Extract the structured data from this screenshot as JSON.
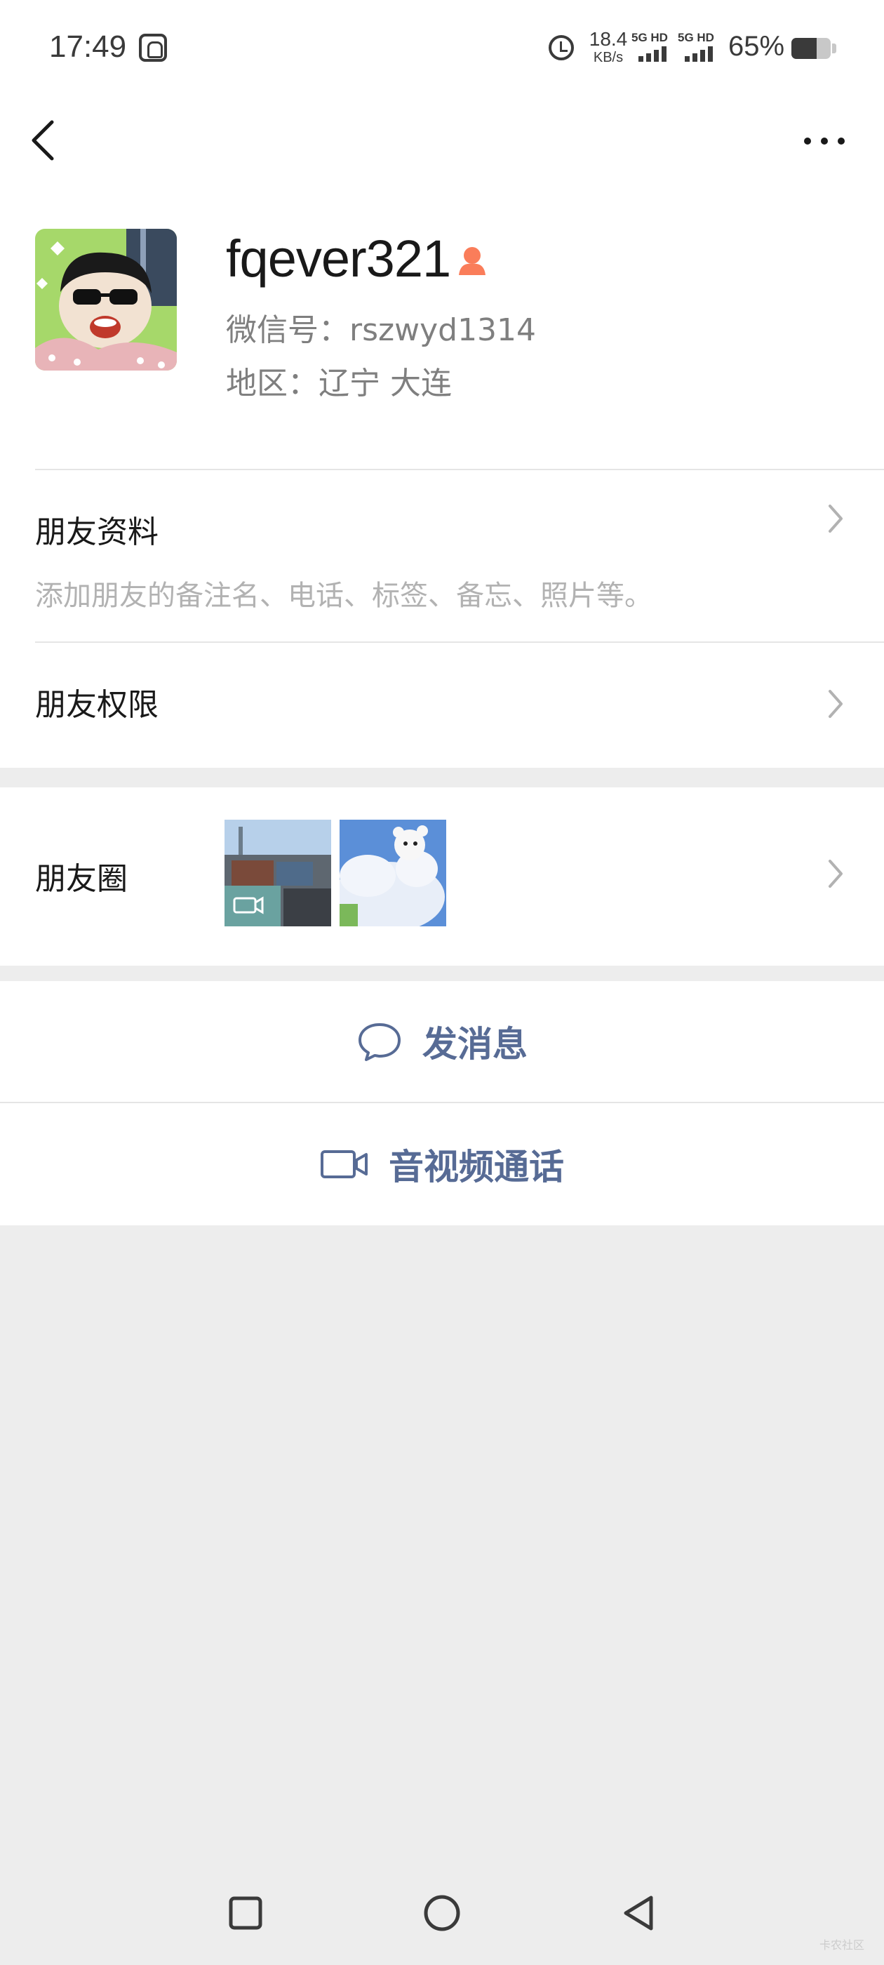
{
  "status_bar": {
    "time": "17:49",
    "net_speed_value": "18.4",
    "net_speed_unit": "KB/s",
    "signal1_label": "5G HD",
    "signal2_label": "5G HD",
    "battery_percent": "65%",
    "battery_level": 0.65,
    "icons": [
      "hand-icon",
      "alarm-icon",
      "signal-icon",
      "battery-icon"
    ]
  },
  "nav": {
    "back_icon": "back-icon",
    "more_icon": "more-icon"
  },
  "profile": {
    "nickname": "fqever321",
    "gender_icon": "female-icon",
    "gender_color": "#fa7d5a",
    "wechat_id": "微信号：rszwyd1314",
    "region": "地区：辽宁  大连"
  },
  "friend_info": {
    "title": "朋友资料",
    "subtitle": "添加朋友的备注名、电话、标签、备忘、照片等。"
  },
  "friend_permission": {
    "title": "朋友权限"
  },
  "moments": {
    "title": "朋友圈",
    "thumbnails": [
      "video-thumbnail",
      "photo-thumbnail"
    ]
  },
  "actions": {
    "send_message": "发消息",
    "video_call": "音视频通话",
    "accent_color": "#576b95"
  },
  "watermark": "卡农社区"
}
